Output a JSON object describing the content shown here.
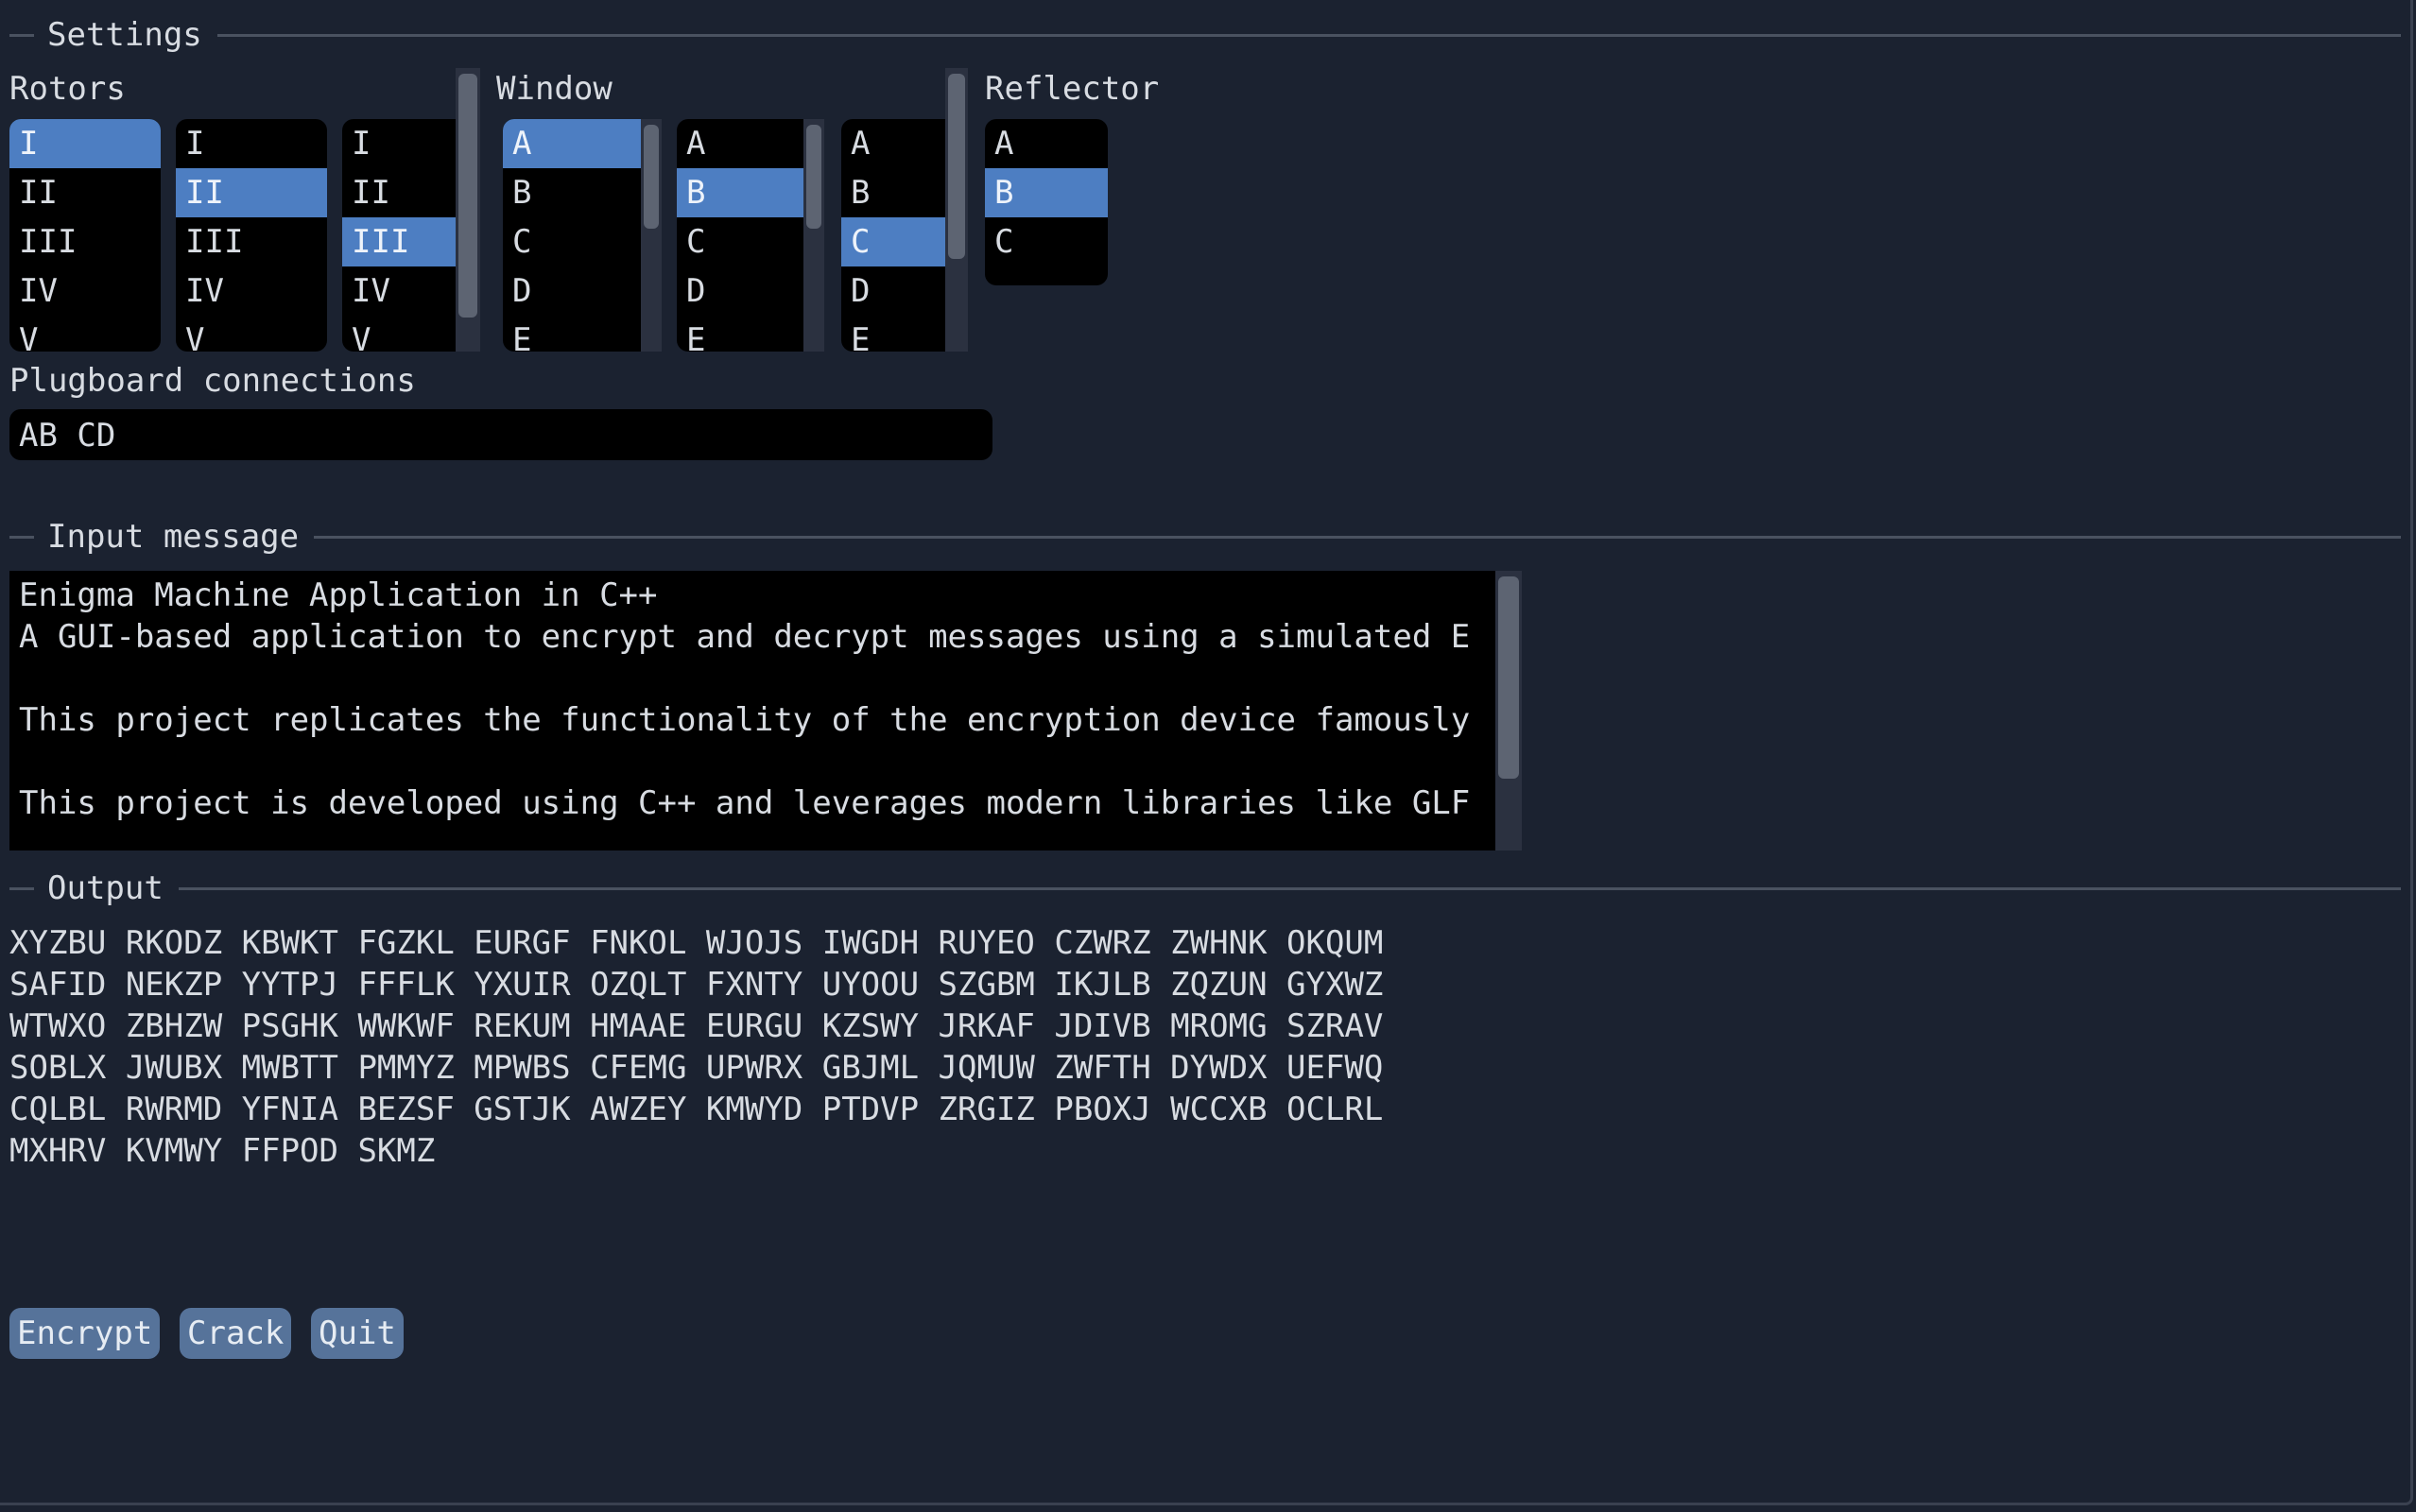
{
  "settings": {
    "title": "Settings",
    "rotors_label": "Rotors",
    "window_label": "Window",
    "reflector_label": "Reflector",
    "rotors": [
      {
        "items": [
          "I",
          "II",
          "III",
          "IV",
          "V"
        ],
        "selected": "I"
      },
      {
        "items": [
          "I",
          "II",
          "III",
          "IV",
          "V"
        ],
        "selected": "II"
      },
      {
        "items": [
          "I",
          "II",
          "III",
          "IV",
          "V"
        ],
        "selected": "III"
      }
    ],
    "windows": [
      {
        "items": [
          "A",
          "B",
          "C",
          "D",
          "E"
        ],
        "selected": "A"
      },
      {
        "items": [
          "A",
          "B",
          "C",
          "D",
          "E"
        ],
        "selected": "B"
      },
      {
        "items": [
          "A",
          "B",
          "C",
          "D",
          "E"
        ],
        "selected": "C"
      }
    ],
    "reflector": {
      "items": [
        "A",
        "B",
        "C"
      ],
      "selected": "B"
    },
    "plugboard_label": "Plugboard connections",
    "plugboard_value": "AB CD"
  },
  "input": {
    "title": "Input message",
    "lines": [
      "Enigma Machine Application in C++",
      "A GUI-based application to encrypt and decrypt messages using a simulated E",
      "",
      "This project replicates the functionality of the encryption device famously",
      "",
      "This project is developed using C++ and leverages modern libraries like GLF"
    ]
  },
  "output": {
    "title": "Output",
    "lines": [
      "XYZBU RKODZ KBWKT FGZKL EURGF FNKOL WJOJS IWGDH RUYEO CZWRZ ZWHNK OKQUM",
      "SAFID NEKZP YYTPJ FFFLK YXUIR OZQLT FXNTY UYOOU SZGBM IKJLB ZQZUN GYXWZ",
      "WTWXO ZBHZW PSGHK WWKWF REKUM HMAAE EURGU KZSWY JRKAF JDIVB MROMG SZRAV",
      "SOBLX JWUBX MWBTT PMMYZ MPWBS CFEMG UPWRX GBJML JQMUW ZWFTH DYWDX UEFWQ",
      "CQLBL RWRMD YFNIA BEZSF GSTJK AWZEY KMWYD PTDVP ZRGIZ PBOXJ WCCXB OCLRL",
      "MXHRV KVMWY FFPOD SKMZ"
    ]
  },
  "buttons": {
    "encrypt": "Encrypt",
    "crack": "Crack",
    "quit": "Quit"
  }
}
